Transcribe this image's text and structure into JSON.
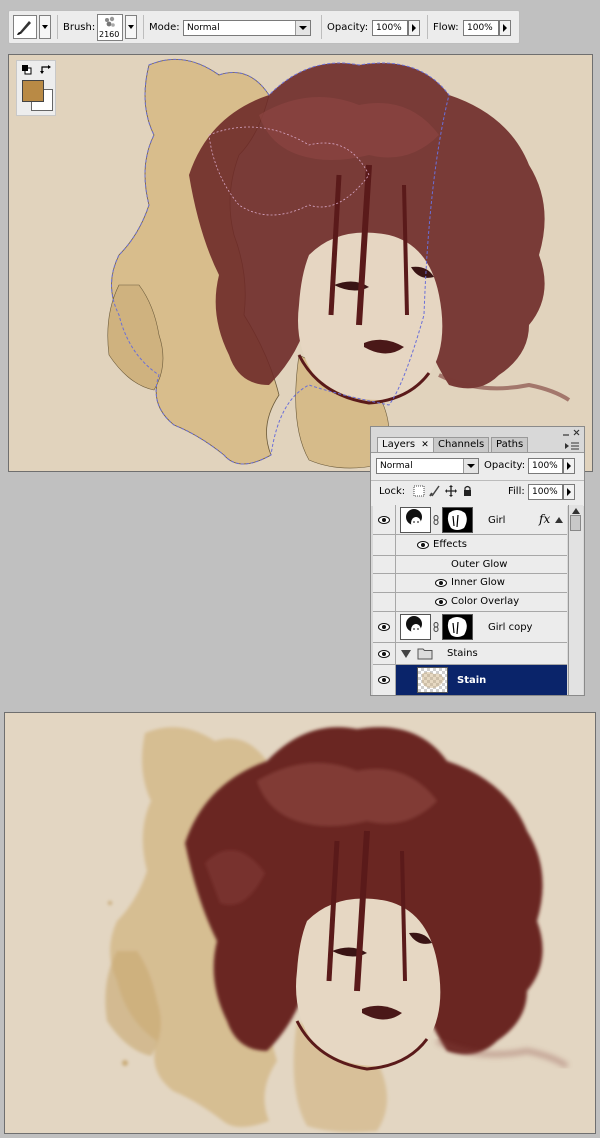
{
  "options_bar": {
    "brush_label": "Brush:",
    "brush_size": "2160",
    "mode_label": "Mode:",
    "mode_value": "Normal",
    "opacity_label": "Opacity:",
    "opacity_value": "100%",
    "flow_label": "Flow:",
    "flow_value": "100%"
  },
  "tools": {
    "foreground_color": "#b98a45",
    "background_color": "#ffffff"
  },
  "layers_panel": {
    "tabs": [
      {
        "label": "Layers",
        "active": true
      },
      {
        "label": "Channels",
        "active": false
      },
      {
        "label": "Paths",
        "active": false
      }
    ],
    "blend_mode": "Normal",
    "opacity_label": "Opacity:",
    "opacity_value": "100%",
    "lock_label": "Lock:",
    "fill_label": "Fill:",
    "fill_value": "100%",
    "layers": {
      "girl": "Girl",
      "effects": "Effects",
      "outer_glow": "Outer Glow",
      "inner_glow": "Inner Glow",
      "color_overlay": "Color Overlay",
      "girl_copy": "Girl copy",
      "stains": "Stains",
      "stain": "Stain"
    },
    "selected_color": "#0a246a"
  },
  "colors": {
    "paper": "#e1d3bd",
    "stain": "#c9ab78",
    "ink": "#5a1a1a"
  }
}
